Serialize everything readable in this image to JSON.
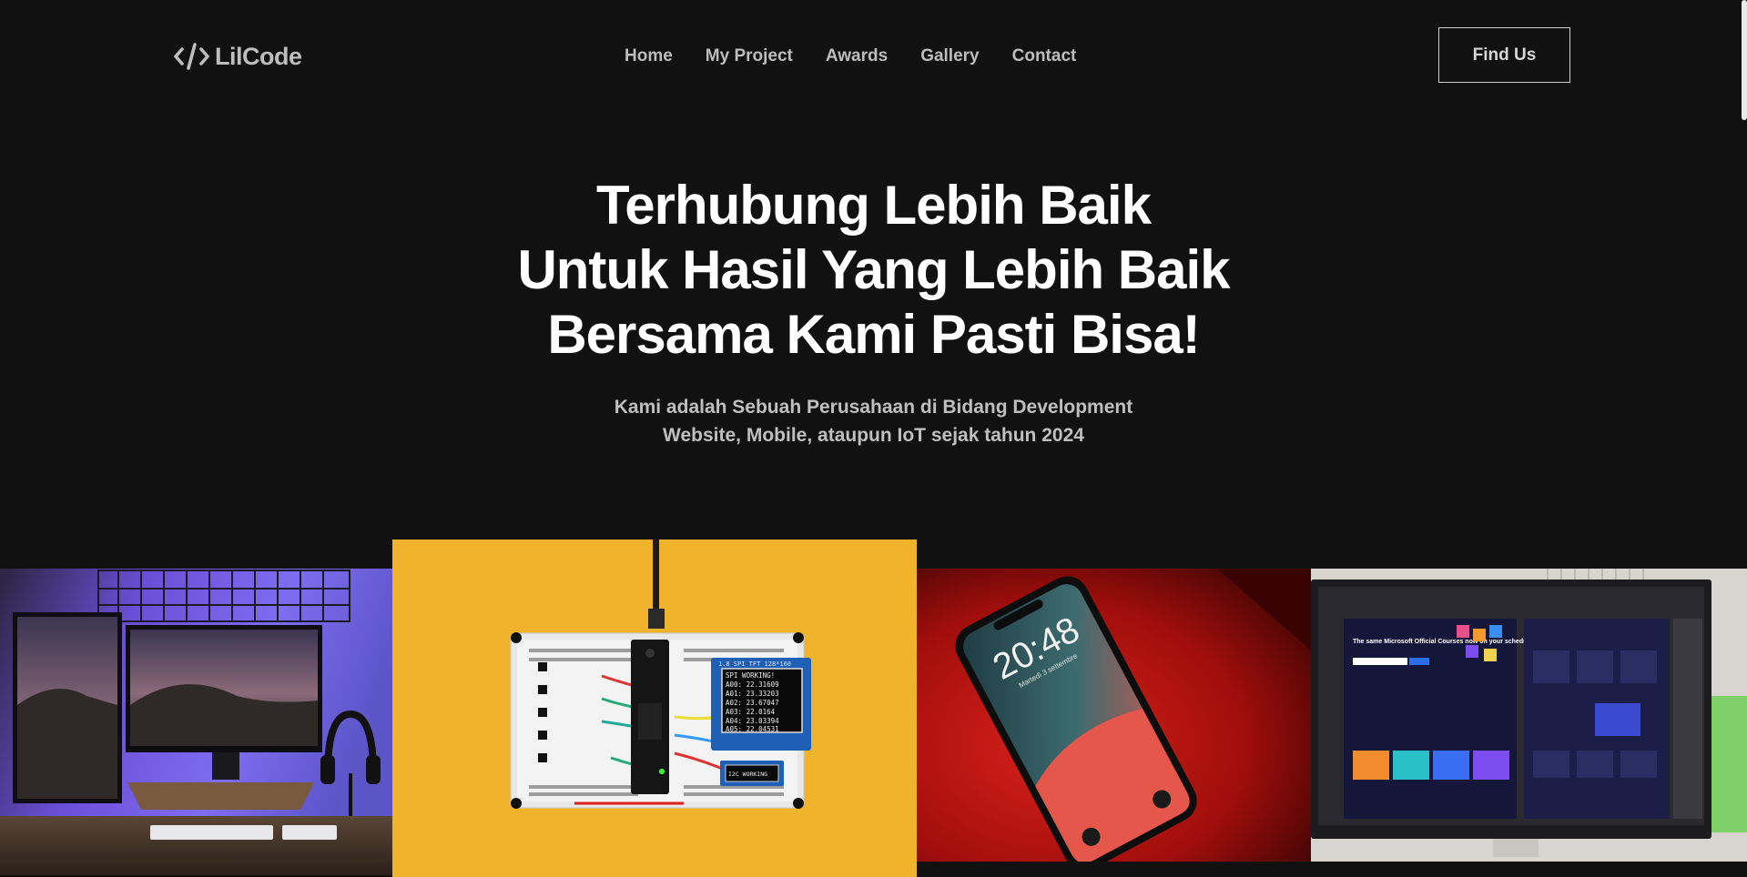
{
  "header": {
    "logo": {
      "text": "LilCode",
      "icon": "code-brackets-icon"
    },
    "nav": [
      {
        "label": "Home"
      },
      {
        "label": "My Project"
      },
      {
        "label": "Awards"
      },
      {
        "label": "Gallery"
      },
      {
        "label": "Contact"
      }
    ],
    "cta_label": "Find Us"
  },
  "hero": {
    "title_lines": [
      "Terhubung Lebih Baik",
      "Untuk Hasil Yang Lebih Baik",
      "Bersama Kami Pasti Bisa!"
    ],
    "subtitle_lines": [
      "Kami adalah Sebuah Perusahaan di Bidang Development",
      "Website, Mobile, ataupun IoT sejak tahun 2024"
    ]
  },
  "gallery": {
    "photos": [
      {
        "name": "desk-setup-photo",
        "clock": ""
      },
      {
        "name": "breadboard-photo",
        "screen_lines": [
          "SPI WORKING!",
          "A00: 22.31609",
          "A01: 23.33203",
          "A02: 23.67047",
          "A03: 22.0164",
          "A04: 23.03394",
          "A05: 22.04531"
        ],
        "board_label": "1.8 SPI TFT 128*160",
        "i2c_label": "I2C WORKING"
      },
      {
        "name": "smartphone-photo",
        "clock": "20:48",
        "date": "Martedì 3 settembre"
      },
      {
        "name": "monitor-photo",
        "screen_heading": "The same Microsoft Official Courses now on your schedule, on-demand"
      }
    ]
  },
  "colors": {
    "background": "#111111",
    "text_primary": "#ffffff",
    "text_muted": "#bdbdbd",
    "button_border": "#cfcfcf"
  }
}
